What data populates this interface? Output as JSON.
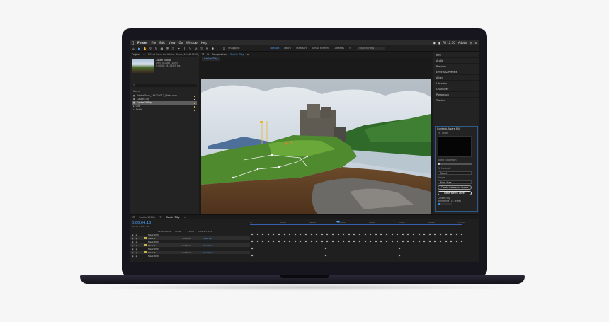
{
  "menubar": {
    "items": [
      "Finder",
      "File",
      "Edit",
      "View",
      "Go",
      "Window",
      "Help"
    ],
    "clock": "Fri 12:10",
    "user": "Adobe"
  },
  "toolbar": {
    "snapping": "Snapping",
    "workspaces": [
      "Default",
      "Learn",
      "Standard",
      "Small Screen",
      "Libraries"
    ],
    "search_placeholder": "Search Help"
  },
  "project": {
    "tabs": [
      "Project",
      "Effect Controls Adobe Stock_144426012_Video.mov"
    ],
    "clip_name": "Castle 1080p",
    "clip_info": [
      "1920 x 1080 (1.00)",
      "0;00;08;16, 29.97 fps"
    ],
    "search_placeholder": "",
    "column": "Name",
    "items": [
      {
        "name": "AdobeStock_144426012_Video.mov",
        "color": "#c9b64b",
        "selected": false
      },
      {
        "name": "Castle Tilty",
        "color": "#d7d7d7",
        "selected": false
      },
      {
        "name": "Castle 1080p",
        "color": "#c9b64b",
        "selected": true
      },
      {
        "name": "Old",
        "color": "#c9b64b",
        "selected": false
      },
      {
        "name": "Solids",
        "color": "#c9b64b",
        "selected": false
      }
    ],
    "bpc": "8 bpc"
  },
  "composition": {
    "tab_label": "Composition",
    "tab_name": "Castle Tilty",
    "subtab": "Castle Tilty",
    "footer": {
      "zoom": "(37.9%)",
      "timecode": "0;00;04;13",
      "resolution": "Full",
      "camera": "Active Camera",
      "views": "1 View",
      "offset": "+0.0"
    }
  },
  "right_panel": {
    "items": [
      "Info",
      "Audio",
      "Preview",
      "Effects & Presets",
      "Align",
      "Libraries",
      "Character",
      "Paragraph",
      "Tracker"
    ],
    "content_aware": {
      "title": "Content-Aware Fill",
      "fill_target": "Fill Target",
      "alpha_expansion": "Alpha Expansion",
      "fill_method_label": "Fill Method",
      "fill_method": "Object",
      "range_label": "Range",
      "range": "Work Area",
      "btn_reference": "Create Reference Frame",
      "btn_generate": "Generate Fill Layer",
      "status_title": "Castle Tilty",
      "status": "Rendering (15 of 66)",
      "progress": 0.22
    }
  },
  "timeline": {
    "tabs": [
      "Castle 1080p",
      "Castle Tilty"
    ],
    "timecode": "0;00;04;13",
    "timecode_sub": "00133 (29.97 fps)",
    "columns": [
      "Layer Name",
      "Mode",
      "T TrkMat",
      "Parent & Link"
    ],
    "ticks": [
      "0f",
      "01:00f",
      "02:00f",
      "03:00f",
      "04:00f",
      "05:00f",
      "06:00f",
      "07:00f"
    ],
    "layers": [
      {
        "name": "Mask Path",
        "mode": "",
        "sub": "",
        "color": ""
      },
      {
        "name": "Mask 1",
        "mode": "Subtract",
        "sub": "Inverted",
        "color": "#c9b64b"
      },
      {
        "name": "Mask Path",
        "mode": "",
        "sub": "",
        "color": ""
      },
      {
        "name": "Mask 2",
        "mode": "Subtract",
        "sub": "Inverted",
        "color": "#c9b64b"
      },
      {
        "name": "Mask Path",
        "mode": "",
        "sub": "",
        "color": ""
      },
      {
        "name": "Mask 3",
        "mode": "Subtract",
        "sub": "Inverted",
        "color": "#c9b64b"
      },
      {
        "name": "Mask Path",
        "mode": "",
        "sub": "",
        "color": ""
      }
    ]
  },
  "colors": {
    "accent": "#4aa3ff",
    "panel": "#232323",
    "laptop": "#17161f"
  }
}
